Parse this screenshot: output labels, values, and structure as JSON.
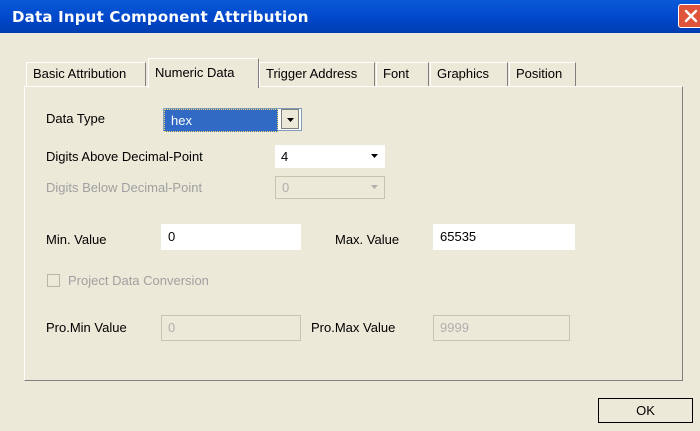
{
  "window": {
    "title": "Data Input Component Attribution"
  },
  "tabs": [
    {
      "label": "Basic Attribution",
      "active": false
    },
    {
      "label": "Numeric Data",
      "active": true
    },
    {
      "label": "Trigger Address",
      "active": false
    },
    {
      "label": "Font",
      "active": false
    },
    {
      "label": "Graphics",
      "active": false
    },
    {
      "label": "Position",
      "active": false
    }
  ],
  "form": {
    "data_type": {
      "label": "Data Type",
      "value": "hex"
    },
    "digits_above": {
      "label": "Digits Above Decimal-Point",
      "value": "4"
    },
    "digits_below": {
      "label": "Digits Below Decimal-Point",
      "value": "0"
    },
    "min_value": {
      "label": "Min. Value",
      "value": "0"
    },
    "max_value": {
      "label": "Max. Value",
      "value": "65535"
    },
    "project_conversion": {
      "label": "Project Data Conversion",
      "checked": false
    },
    "pro_min": {
      "label": "Pro.Min Value",
      "value": "0"
    },
    "pro_max": {
      "label": "Pro.Max Value",
      "value": "9999"
    }
  },
  "buttons": {
    "ok_label": "OK"
  },
  "icons": {
    "close": "close-icon",
    "dropdown": "chevron-down-icon"
  },
  "colors": {
    "titlebar": "#0a5ad8",
    "selection": "#316ac5",
    "close": "#e0543a",
    "face": "#ece9d8"
  }
}
